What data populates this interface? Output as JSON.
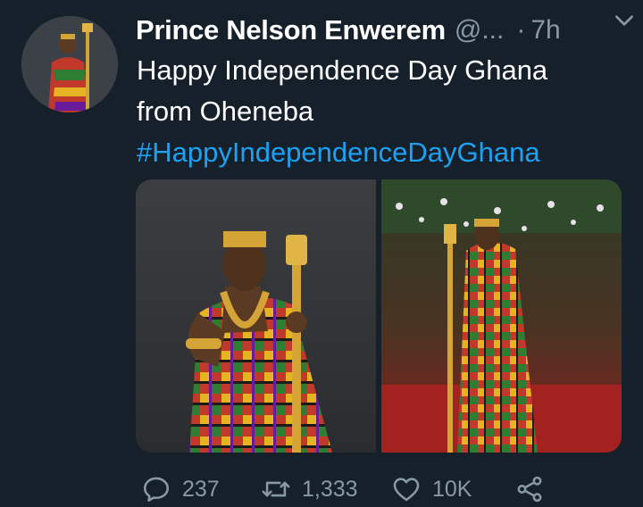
{
  "tweet": {
    "author_name": "Prince Nelson Enwerem",
    "handle": "@...",
    "separator": "·",
    "time": "7h",
    "text_line1": "Happy Independence Day Ghana",
    "text_line2": "from Oheneba",
    "hashtag": "#HappyIndependenceDayGhana"
  },
  "actions": {
    "replies": "237",
    "retweets": "1,333",
    "likes": "10K"
  },
  "colors": {
    "background": "#15202b",
    "text": "#ffffff",
    "muted": "#8899a6",
    "link": "#1da1f2"
  },
  "icons": {
    "reply": "reply-icon",
    "retweet": "retweet-icon",
    "like": "heart-icon",
    "share": "share-icon",
    "menu": "chevron-down-icon"
  }
}
